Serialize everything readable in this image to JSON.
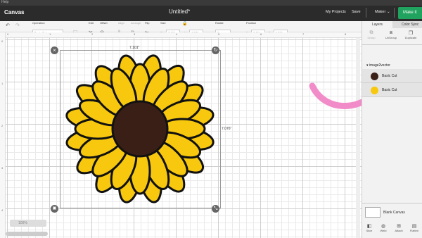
{
  "window": {
    "menu_hint": "Help",
    "app_title": "Canvas",
    "doc_title": "Untitled*"
  },
  "nav": {
    "my_projects": "My Projects",
    "save": "Save",
    "machine": "Maker",
    "make_it": "Make It"
  },
  "toolbar": {
    "operation": {
      "label": "Operation",
      "value": "Basic Cut"
    },
    "edit": "Edit",
    "offset": "Offset",
    "align": "Align",
    "arrange": "Arrange",
    "flip": "Flip",
    "size": "Size",
    "w_label": "W",
    "w_value": "7.101",
    "h_label": "H",
    "h_value": "7.076",
    "rotate": "Rotate",
    "rotate_value": "0",
    "position": "Position",
    "x_label": "X",
    "x_value": "2.264",
    "y_label": "Y",
    "y_value": "0.389"
  },
  "rulers": {
    "top": [
      "0",
      "1",
      "2",
      "3",
      "4",
      "5",
      "6",
      "7",
      "8"
    ],
    "left": [
      "0",
      "1",
      "2",
      "3",
      "4",
      "5"
    ]
  },
  "canvas": {
    "width_label": "7.101\"",
    "height_label": "7.076\"",
    "zoom_value": "100%",
    "colors": {
      "petal": "#F7C80E",
      "center": "#3A1F16",
      "outline": "#111111",
      "arrow": "#F28CC9"
    }
  },
  "panel": {
    "tabs": [
      "Layers",
      "Color Sync"
    ],
    "tools": [
      "Group",
      "UnGroup",
      "Duplicate"
    ],
    "group_name": "image2vector",
    "layers": [
      {
        "label": "Basic Cut",
        "color": "#3A1F16"
      },
      {
        "label": "Basic Cut",
        "color": "#F7C80E"
      }
    ],
    "blank_canvas": "Blank Canvas",
    "bottom_tools": [
      "Slice",
      "Weld",
      "Attach",
      "Flatten"
    ]
  }
}
